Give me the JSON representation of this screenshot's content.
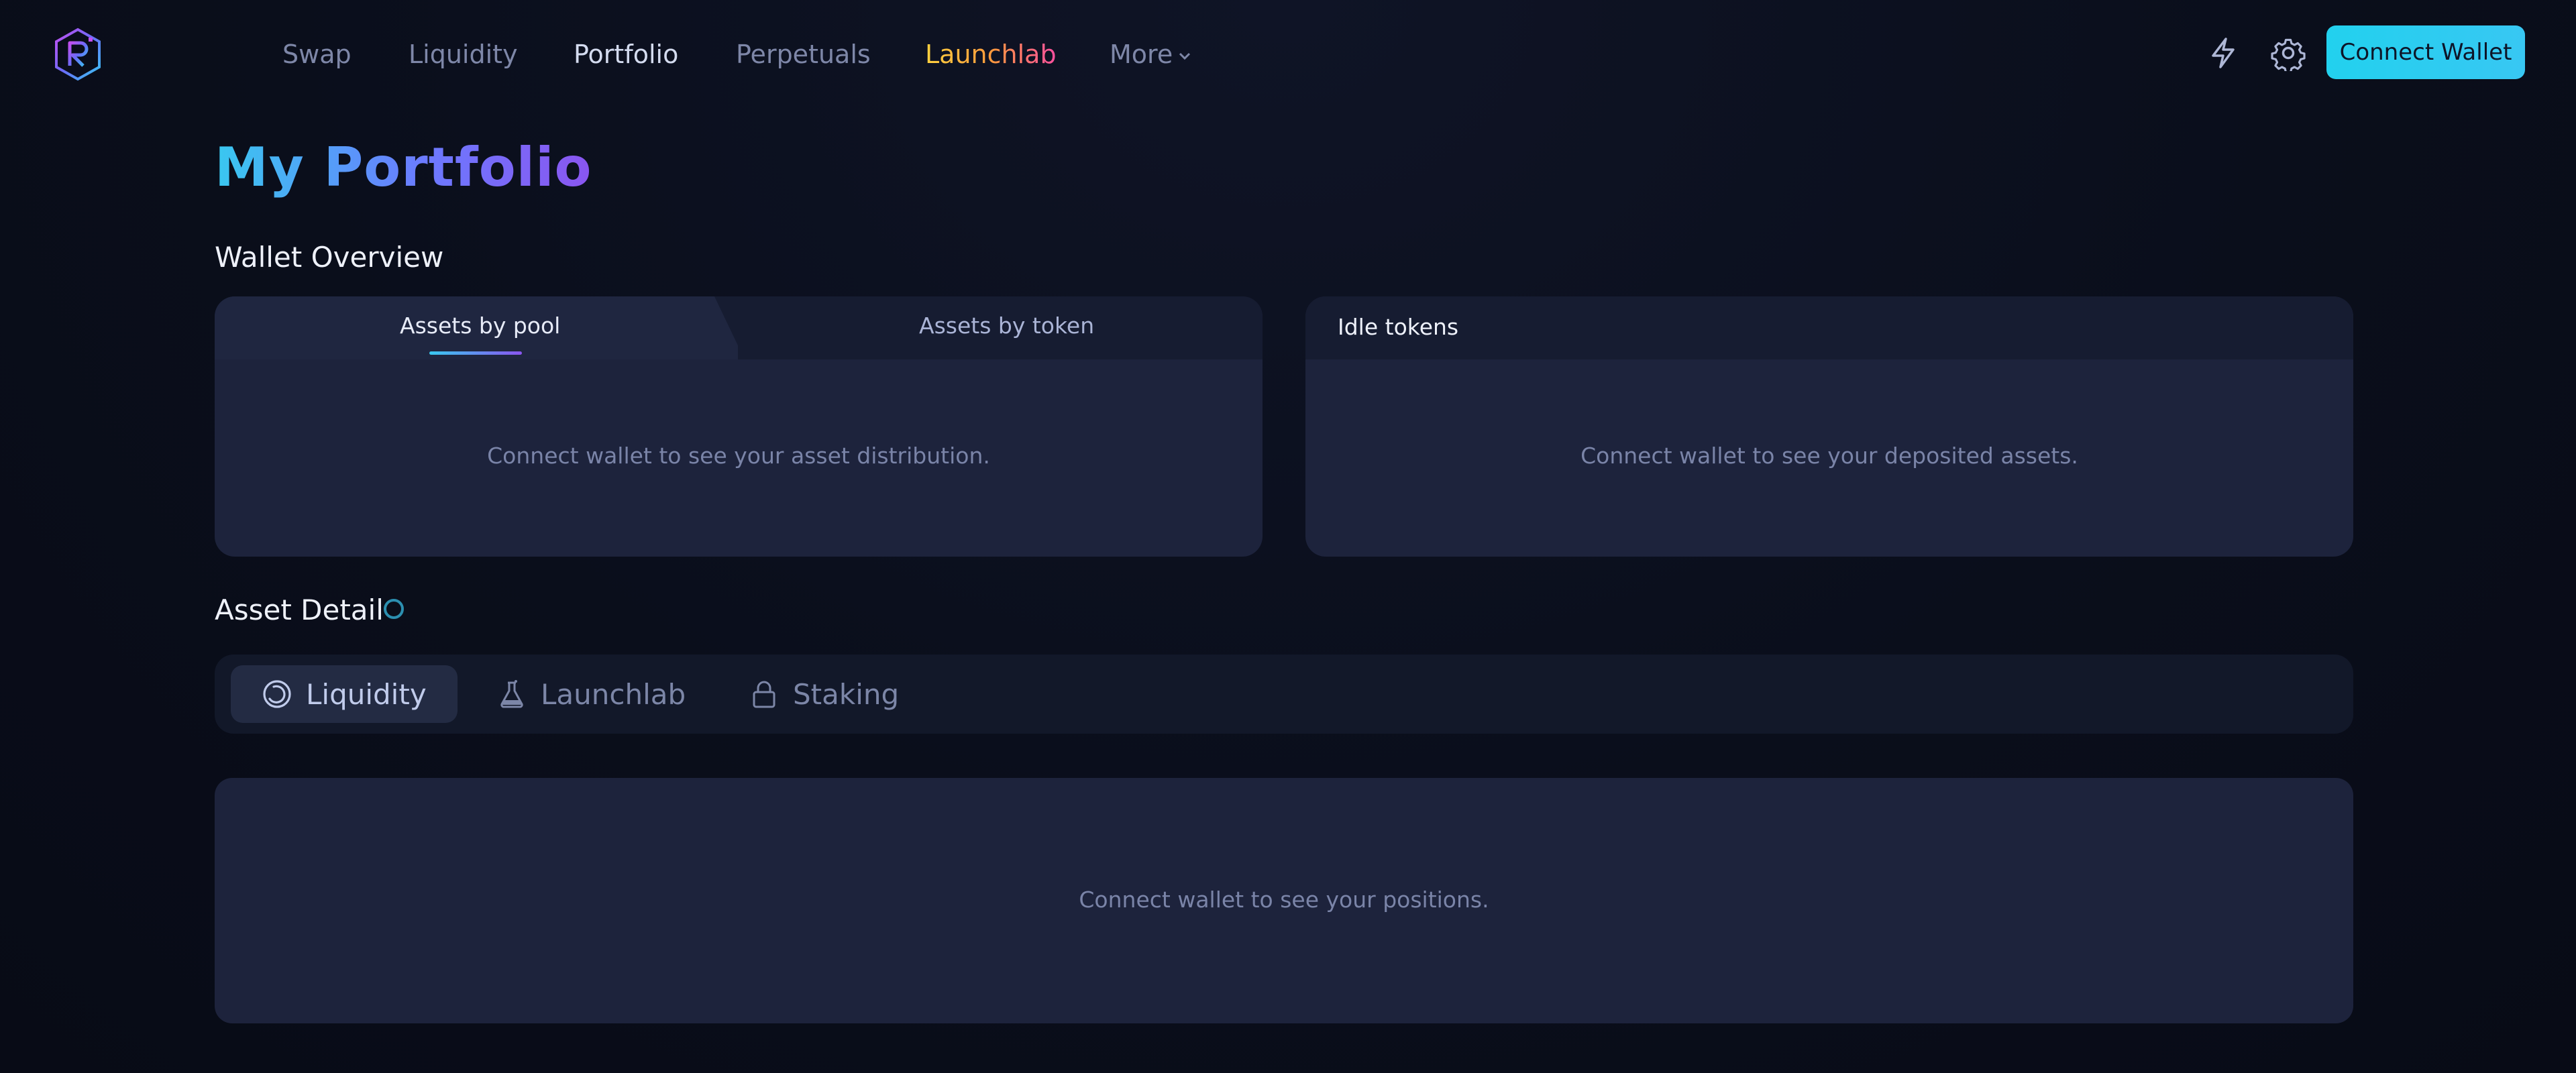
{
  "header": {
    "logo_icon": "raydium-logo",
    "nav": [
      {
        "label": "Swap"
      },
      {
        "label": "Liquidity"
      },
      {
        "label": "Portfolio"
      },
      {
        "label": "Perpetuals"
      },
      {
        "label": "Launchlab"
      },
      {
        "label": "More"
      }
    ],
    "actions": {
      "priority_icon": "lightning-icon",
      "settings_icon": "gear-icon",
      "connect_label": "Connect Wallet"
    }
  },
  "page": {
    "title": "My Portfolio"
  },
  "wallet_overview": {
    "heading": "Wallet Overview",
    "distribution_card": {
      "tabs": [
        {
          "label": "Assets by pool",
          "active": true
        },
        {
          "label": "Assets by token",
          "active": false
        }
      ],
      "message": "Connect wallet to see your asset distribution."
    },
    "idle_card": {
      "title": "Idle tokens",
      "message": "Connect wallet to see your deposited assets."
    }
  },
  "asset_detail": {
    "heading": "Asset Detail",
    "tabs": [
      {
        "label": "Liquidity",
        "icon": "liquidity-icon",
        "active": true
      },
      {
        "label": "Launchlab",
        "icon": "flask-icon",
        "active": false
      },
      {
        "label": "Staking",
        "icon": "lock-icon",
        "active": false
      }
    ],
    "message": "Connect wallet to see your positions."
  },
  "colors": {
    "accent_cyan": "#22d1ee",
    "accent_purple": "#8a55f0",
    "card_bg": "#1d233c",
    "page_bg": "#0a0e1b",
    "muted_text": "#7a84a8"
  }
}
